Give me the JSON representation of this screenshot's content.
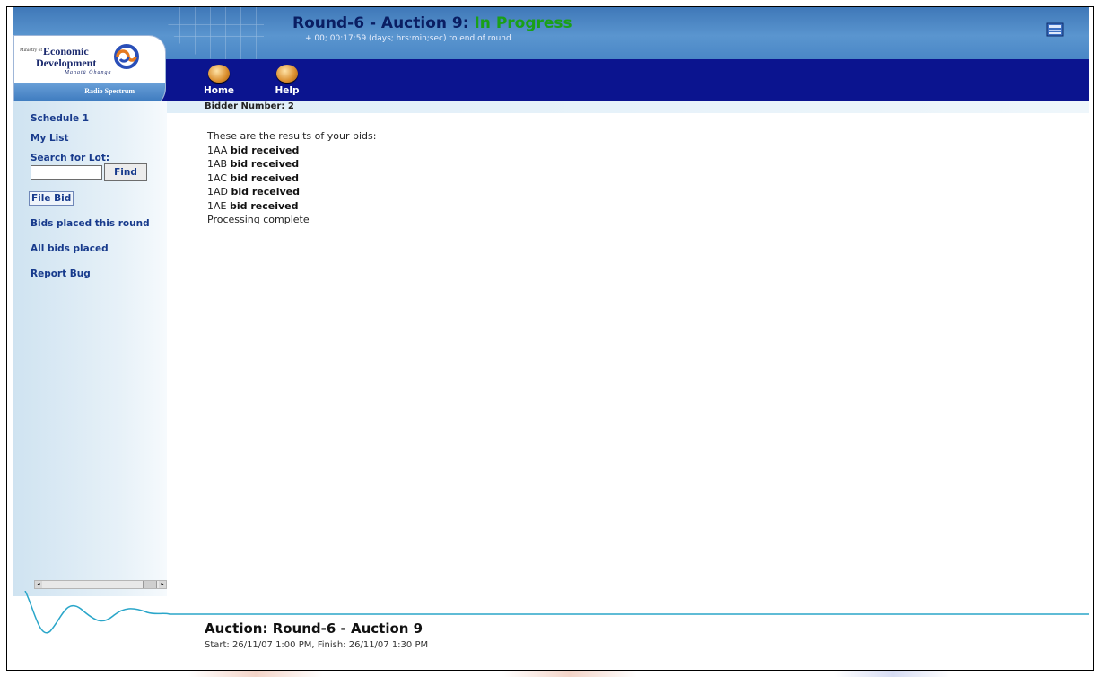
{
  "header": {
    "title_prefix": "Round-6 - Auction 9: ",
    "title_status": "In Progress",
    "countdown": "+ 00; 00:17:59 (days; hrs:min;sec) to end of round",
    "status_color": "#1aa017"
  },
  "logo": {
    "ministry": "Ministry of",
    "economic": "Economic",
    "development": "Development",
    "maori": "Manatū Ōhanga",
    "bar": "Radio Spectrum"
  },
  "nav": {
    "home_label": "Home",
    "help_label": "Help"
  },
  "bidder": {
    "label": "Bidder Number: 2"
  },
  "sidebar": {
    "schedule": "Schedule 1",
    "my_list": "My List",
    "search_label": "Search for Lot:",
    "search_value": "",
    "find_label": "Find",
    "file_bid": "File Bid",
    "bids_round": "Bids placed this round",
    "all_bids": "All bids placed",
    "report_bug": "Report Bug"
  },
  "results": {
    "intro": "These are the results of your bids:",
    "rows": [
      {
        "lot": "1AA",
        "status": "bid received"
      },
      {
        "lot": "1AB",
        "status": "bid received"
      },
      {
        "lot": "1AC",
        "status": "bid received"
      },
      {
        "lot": "1AD",
        "status": "bid received"
      },
      {
        "lot": "1AE",
        "status": "bid received"
      }
    ],
    "complete": "Processing complete"
  },
  "footer": {
    "title": "Auction: Round-6 - Auction 9",
    "times": "Start: 26/11/07 1:00 PM, Finish: 26/11/07 1:30 PM"
  },
  "icons": {
    "corner": "window-icon",
    "nav_ball": "orb-icon"
  },
  "colors": {
    "nav_band": "#0b148f",
    "link": "#173a8c",
    "accent_green": "#1aa017"
  }
}
